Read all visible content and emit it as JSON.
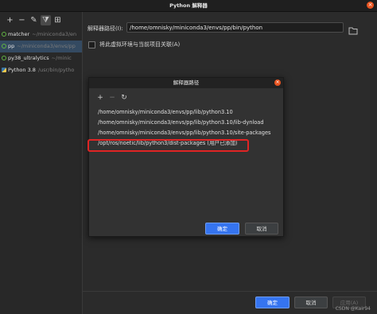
{
  "window": {
    "title": "Python 解释器"
  },
  "left_panel": {
    "toolbar": [
      {
        "icon": "plus-icon",
        "glyph": "+"
      },
      {
        "icon": "minus-icon",
        "glyph": "−"
      },
      {
        "icon": "pencil-icon",
        "glyph": "✎"
      },
      {
        "icon": "filter-icon",
        "glyph": "⧩"
      },
      {
        "icon": "tree-icon",
        "glyph": "⊞"
      }
    ],
    "interpreters": [
      {
        "name": "matcher",
        "path": "~/miniconda3/en",
        "selected": false,
        "icon": "venv-icon"
      },
      {
        "name": "pp",
        "path": "~/miniconda3/envs/pp",
        "selected": true,
        "icon": "venv-icon"
      },
      {
        "name": "py38_ultralytics",
        "path": "~/minic",
        "selected": false,
        "icon": "venv-icon"
      },
      {
        "name": "Python 3.8",
        "path": "/usr/bin/pytho",
        "selected": false,
        "icon": "python-icon"
      }
    ]
  },
  "right_panel": {
    "path_label": "解释器路径(I):",
    "path_value": "/home/omnisky/miniconda3/envs/pp/bin/python",
    "associate_label": "将此虚拟环境与当前项目关联(A)"
  },
  "dialog": {
    "title": "解释器路径",
    "tools": [
      {
        "icon": "plus-icon",
        "glyph": "+",
        "enabled": true
      },
      {
        "icon": "minus-icon",
        "glyph": "−",
        "enabled": false
      },
      {
        "icon": "refresh-icon",
        "glyph": "↻",
        "enabled": true
      }
    ],
    "paths": [
      "/home/omnisky/miniconda3/envs/pp/lib/python3.10",
      "/home/omnisky/miniconda3/envs/pp/lib/python3.10/lib-dynload",
      "/home/omnisky/miniconda3/envs/pp/lib/python3.10/site-packages",
      "/opt/ros/noetic/lib/python3/dist-packages  (用户已添加)"
    ],
    "ok_label": "确定",
    "cancel_label": "取消"
  },
  "footer": {
    "ok_label": "确定",
    "cancel_label": "取消",
    "apply_label": "应用(A)"
  },
  "watermark": "CSDN @Kair94",
  "colors": {
    "accent": "#3574f0",
    "highlight": "#e02424",
    "close": "#e95420"
  }
}
